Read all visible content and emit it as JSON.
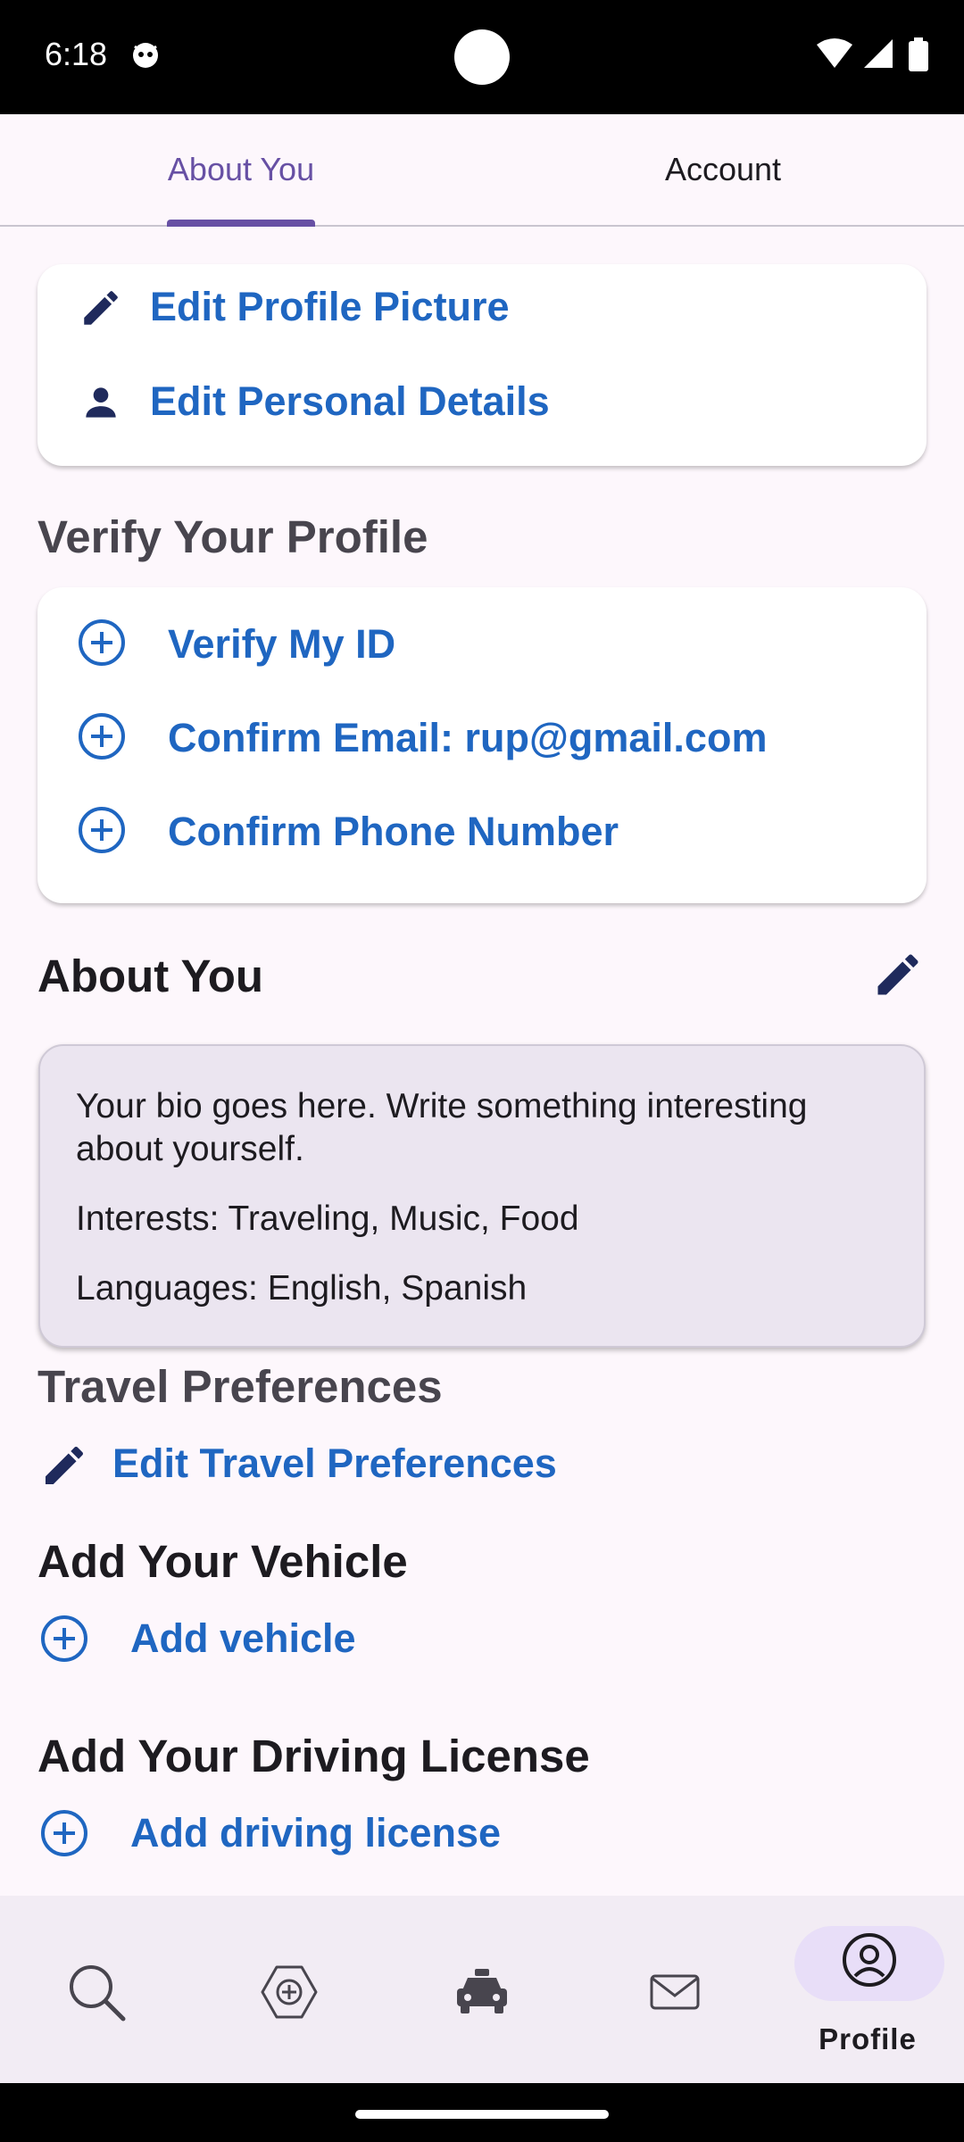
{
  "status_bar": {
    "time": "6:18"
  },
  "tabs": [
    {
      "label": "About You",
      "active": true
    },
    {
      "label": "Account",
      "active": false
    }
  ],
  "profile_card": {
    "edit_picture": "Edit Profile Picture",
    "edit_details": "Edit Personal Details"
  },
  "verify": {
    "title": "Verify Your Profile",
    "items": [
      "Verify My ID",
      "Confirm Email: rup@gmail.com",
      "Confirm Phone Number"
    ]
  },
  "about": {
    "title": "About You",
    "bio": "Your bio goes here. Write something interesting about yourself.",
    "interests": "Interests: Traveling, Music, Food",
    "languages": "Languages: English, Spanish"
  },
  "travel": {
    "title": "Travel Preferences",
    "edit": "Edit Travel Preferences"
  },
  "vehicle": {
    "title": "Add Your Vehicle",
    "add": "Add vehicle"
  },
  "license": {
    "title": "Add Your Driving License",
    "add": "Add driving license"
  },
  "bottom_nav": [
    {
      "icon": "search-icon"
    },
    {
      "icon": "add-ride-icon"
    },
    {
      "icon": "car-icon"
    },
    {
      "icon": "mail-icon"
    },
    {
      "icon": "profile-icon",
      "label": "Profile",
      "active": true
    }
  ],
  "colors": {
    "accent": "#6750a4",
    "link": "#1f66c1",
    "background": "#fdf7fc"
  }
}
